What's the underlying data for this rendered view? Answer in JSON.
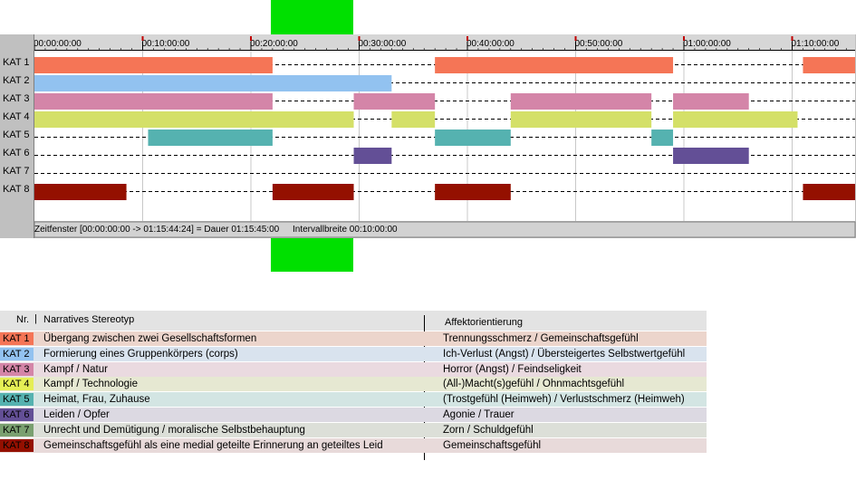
{
  "timeline": {
    "time_ticks": [
      "00:00:00:00",
      "00:10:00:00",
      "00:20:00:00",
      "00:30:00:00",
      "00:40:00:00",
      "00:50:00:00",
      "01:00:00:00",
      "01:10:00:00"
    ],
    "tracks": [
      {
        "label": "KAT 1",
        "color": "#f57556",
        "segments": [
          [
            0,
            22
          ],
          [
            37,
            59
          ],
          [
            71,
            76
          ]
        ]
      },
      {
        "label": "KAT 2",
        "color": "#92c2f0",
        "segments": [
          [
            0,
            33
          ]
        ]
      },
      {
        "label": "KAT 3",
        "color": "#d485a8",
        "segments": [
          [
            0,
            22
          ],
          [
            29.5,
            37
          ],
          [
            44,
            57
          ],
          [
            59,
            66
          ]
        ]
      },
      {
        "label": "KAT 4",
        "color": "#d4e068",
        "segments": [
          [
            0,
            29.5
          ],
          [
            33,
            37
          ],
          [
            44,
            57
          ],
          [
            59,
            70.5
          ]
        ]
      },
      {
        "label": "KAT 5",
        "color": "#55b2b0",
        "segments": [
          [
            10.5,
            22
          ],
          [
            37,
            44
          ],
          [
            57,
            59
          ]
        ]
      },
      {
        "label": "KAT 6",
        "color": "#634f96",
        "segments": [
          [
            29.5,
            33
          ],
          [
            59,
            66
          ]
        ]
      },
      {
        "label": "KAT 7",
        "color": "#7aa070",
        "segments": []
      },
      {
        "label": "KAT 8",
        "color": "#941000",
        "segments": [
          [
            0,
            8.5
          ],
          [
            22,
            29.5
          ],
          [
            37,
            44
          ],
          [
            71,
            76
          ]
        ]
      }
    ],
    "status": {
      "window": "Zeitfenster [00:00:00:00 -> 01:15:44:24] = Dauer 01:15:45:00",
      "interval": "Intervallbreite 00:10:00:00"
    }
  },
  "legend": {
    "headers": {
      "nr": "Nr.",
      "stereotype": "Narratives Stereotyp",
      "affect": "Affektorientierung"
    },
    "rows": [
      {
        "kat": "KAT 1",
        "color": "#f57556",
        "bg": "#ecd5cc",
        "name": "Übergang zwischen zwei Gesellschaftsformen",
        "affect": "Trennungsschmerz / Gemeinschaftsgefühl"
      },
      {
        "kat": "KAT 2",
        "color": "#92c2f0",
        "bg": "#d9e3ee",
        "name": "Formierung eines Gruppenkörpers (corps)",
        "affect": "Ich-Verlust (Angst) / Übersteigertes Selbstwertgefühl"
      },
      {
        "kat": "KAT 3",
        "color": "#d485a8",
        "bg": "#eadae0",
        "name": "Kampf / Natur",
        "affect": "Horror (Angst) / Feindseligkeit"
      },
      {
        "kat": "KAT 4",
        "color": "#e5ee55",
        "bg": "#e6e8d2",
        "name": "Kampf / Technologie",
        "affect": "(All-)Macht(s)gefühl / Ohnmachtsgefühl"
      },
      {
        "kat": "KAT 5",
        "color": "#55b2b0",
        "bg": "#d3e5e3",
        "name": "Heimat, Frau, Zuhause",
        "affect": "(Trostgefühl (Heimweh) / Verlustschmerz (Heimweh)"
      },
      {
        "kat": "KAT 6",
        "color": "#634f96",
        "bg": "#dcd9e2",
        "name": "Leiden / Opfer",
        "affect": "Agonie / Trauer"
      },
      {
        "kat": "KAT 7",
        "color": "#7aa070",
        "bg": "#dcdfd8",
        "name": "Unrecht und Demütigung / moralische Selbstbehauptung",
        "affect": "Zorn / Schuldgefühl"
      },
      {
        "kat": "KAT 8",
        "color": "#941000",
        "bg": "#e8dada",
        "name": "Gemeinschaftsgefühl als eine medial geteilte Erinnerung an geteiltes Leid",
        "affect": "Gemeinschaftsgefühl"
      }
    ]
  }
}
